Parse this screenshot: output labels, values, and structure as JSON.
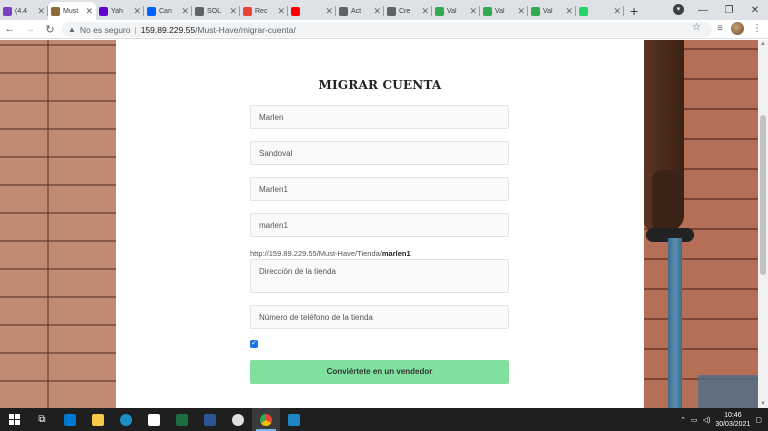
{
  "browser": {
    "tabs": [
      {
        "title": "(4.4",
        "color": "#7b3fbf"
      },
      {
        "title": "Must",
        "color": "#8b6b3a",
        "active": true
      },
      {
        "title": "Yah",
        "color": "#6001d2"
      },
      {
        "title": "Can",
        "color": "#0061fe"
      },
      {
        "title": "SOL",
        "color": "#5f6368"
      },
      {
        "title": "Rec",
        "color": "#ea4335"
      },
      {
        "title": "",
        "color": "#ff0000"
      },
      {
        "title": "Act",
        "color": "#5f6368"
      },
      {
        "title": "Cre",
        "color": "#5f6368"
      },
      {
        "title": "Val",
        "color": "#34a853"
      },
      {
        "title": "Val",
        "color": "#34a853"
      },
      {
        "title": "Val",
        "color": "#34a853"
      },
      {
        "title": "",
        "color": "#25d366"
      }
    ],
    "tab_close": "✕",
    "new_tab": "+",
    "window_controls": {
      "minimize": "—",
      "restore": "❐",
      "close": "✕"
    },
    "address": {
      "insecure_label": "No es seguro",
      "divider": "|",
      "host": "159.89.229.55",
      "path": "/Must-Have/migrar-cuenta/"
    }
  },
  "form": {
    "title": "MIGRAR CUENTA",
    "first_name": "Marlen",
    "last_name": "Sandoval",
    "shop_name": "Marlen1",
    "shop_slug": "marlen1",
    "store_url_prefix": "http://159.89.229.55/Must-Have/Tienda/",
    "store_url_slug": "marlen1",
    "address_placeholder": "Dirección de la tienda",
    "phone_placeholder": "Número de teléfono de la tienda",
    "terms_checked": true,
    "submit_label": "Conviértete en un vendedor"
  },
  "taskbar": {
    "time": "10:46",
    "date": "30/03/2021"
  },
  "colors": {
    "submit_bg": "#7fe0a0",
    "accent": "#1a73e8"
  }
}
